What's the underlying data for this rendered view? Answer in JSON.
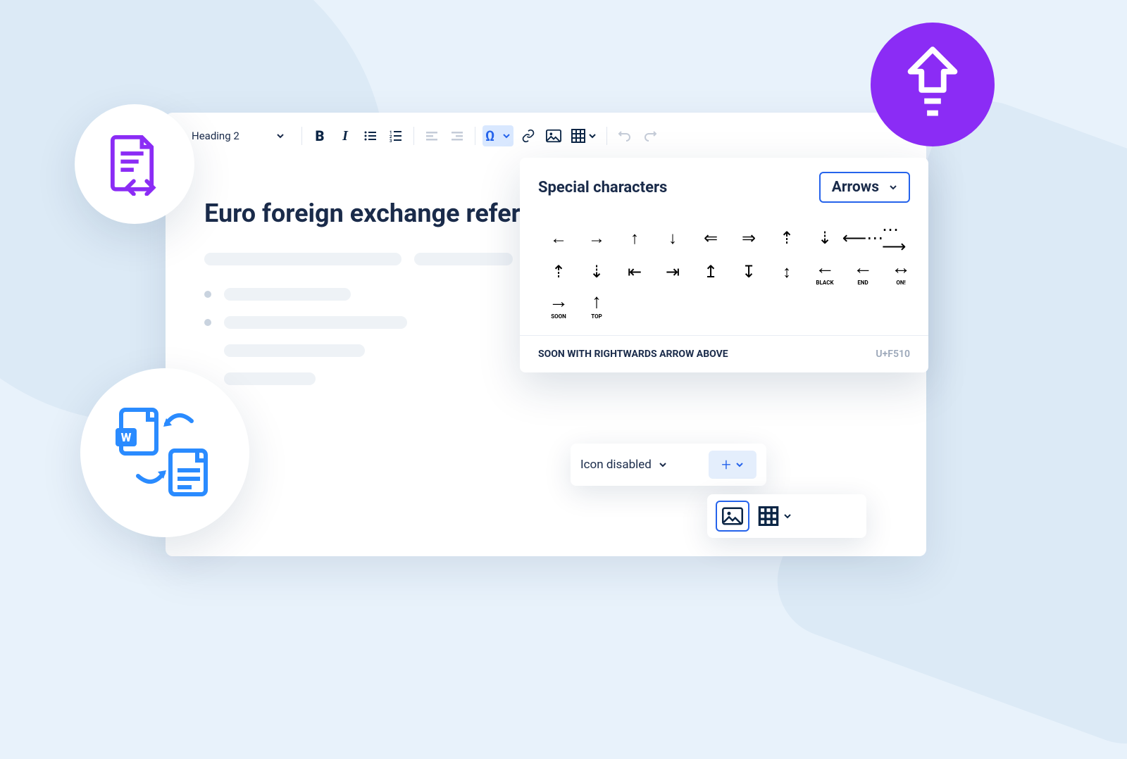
{
  "toolbar": {
    "heading_selector": "Heading 2"
  },
  "document": {
    "title": "Euro foreign exchange reference rates"
  },
  "special_chars": {
    "title": "Special characters",
    "category": "Arrows",
    "chars": [
      {
        "g": "←"
      },
      {
        "g": "→"
      },
      {
        "g": "↑"
      },
      {
        "g": "↓"
      },
      {
        "g": "⇐"
      },
      {
        "g": "⇒"
      },
      {
        "g": "⇡"
      },
      {
        "g": "⇣"
      },
      {
        "g": "⟵⋯"
      },
      {
        "g": "⋯⟶"
      },
      {
        "g": "⇡",
        "dotted": true
      },
      {
        "g": "⇣",
        "dotted": true
      },
      {
        "g": "⇤"
      },
      {
        "g": "⇥"
      },
      {
        "g": "↥"
      },
      {
        "g": "↧"
      },
      {
        "g": "↕"
      },
      {
        "g": "←",
        "lbl": "BLACK",
        "bold": true
      },
      {
        "g": "←",
        "lbl": "END",
        "bold": true
      },
      {
        "g": "↔",
        "lbl": "ON!",
        "bold": true
      },
      {
        "g": "→",
        "lbl": "SOON",
        "bold": true
      },
      {
        "g": "↑",
        "lbl": "TOP",
        "bold": true
      }
    ],
    "selected_name": "SOON WITH RIGHTWARDS ARROW ABOVE",
    "selected_code": "U+F510"
  },
  "icon_callout": {
    "label": "Icon disabled"
  }
}
